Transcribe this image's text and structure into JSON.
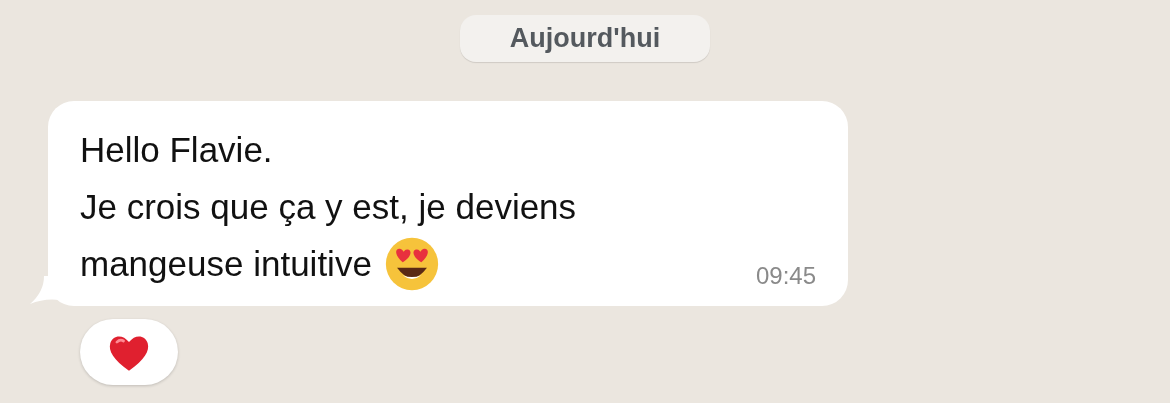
{
  "date_separator": "Aujourd'hui",
  "message": {
    "lines": [
      "Hello Flavie.",
      "Je crois que ça y est, je deviens",
      "mangeuse intuitive"
    ],
    "trailing_icon": {
      "kind": "heart_eyes"
    },
    "time": "09:45",
    "reaction": {
      "kind": "heart"
    }
  }
}
